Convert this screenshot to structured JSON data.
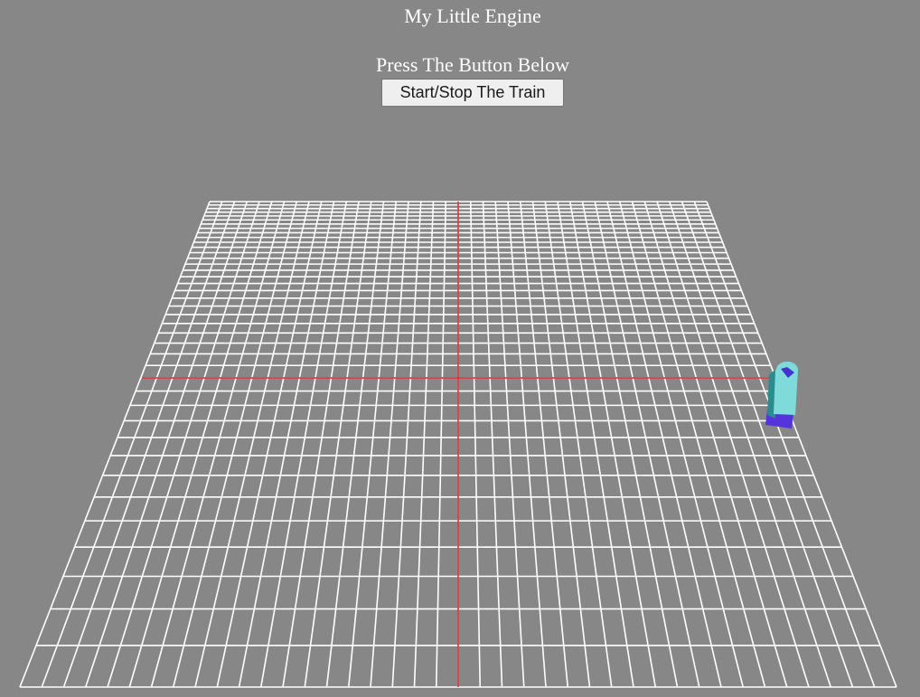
{
  "header": {
    "title": "My Little Engine",
    "subtitle": "Press The Button Below"
  },
  "controls": {
    "start_stop_label": "Start/Stop The Train"
  },
  "scene": {
    "background": "#878787",
    "grid_color": "#ffffff",
    "axis_color": "#cc2222",
    "train_body_color": "#7fdada",
    "train_dark_color": "#2a8c8c",
    "train_base_color": "#5533dd"
  }
}
